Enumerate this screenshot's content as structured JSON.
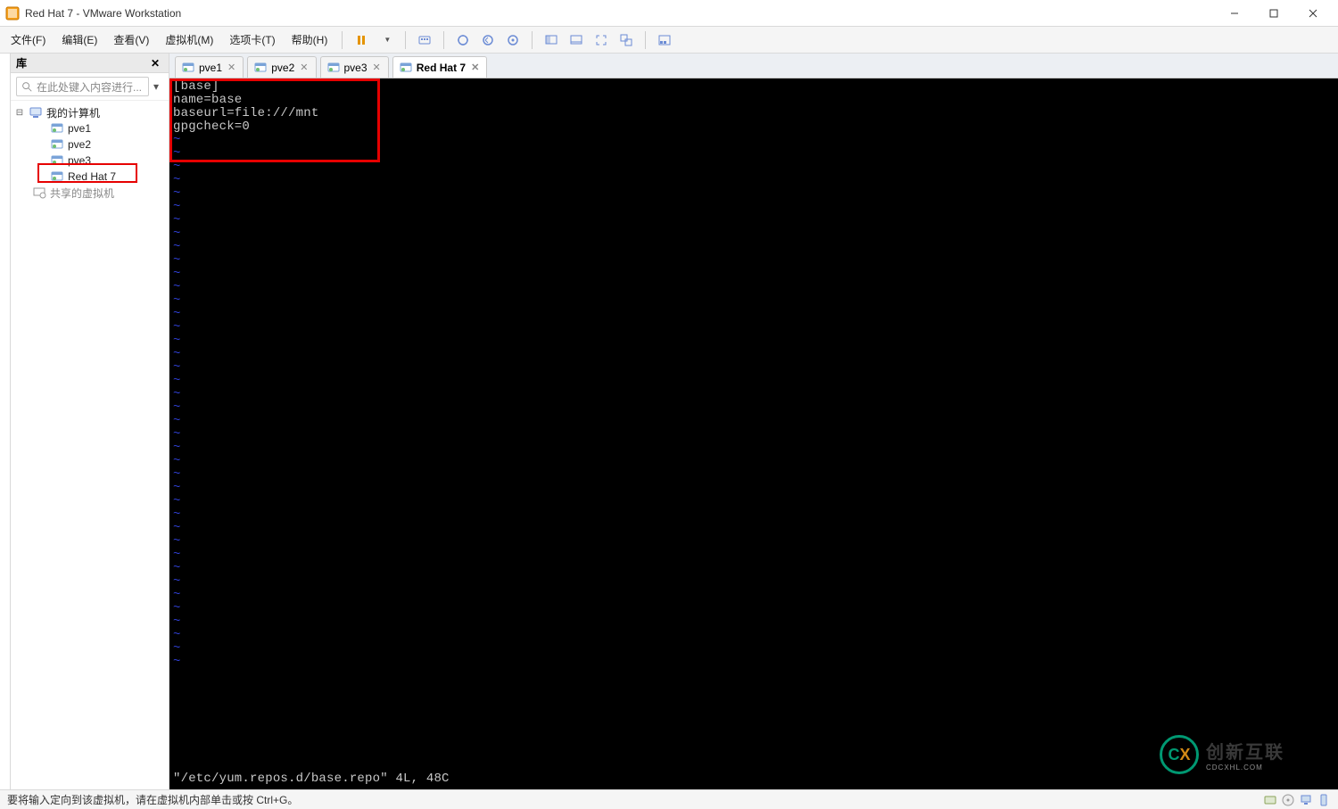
{
  "window": {
    "title": "Red Hat 7 - VMware Workstation"
  },
  "menubar": {
    "items": [
      "文件(F)",
      "编辑(E)",
      "查看(V)",
      "虚拟机(M)",
      "选项卡(T)",
      "帮助(H)"
    ]
  },
  "toolbar": {
    "icons": [
      "pause-icon",
      "power-dropdown",
      "send-keys-icon",
      "snapshot-take-icon",
      "snapshot-revert-icon",
      "snapshot-manager-icon",
      "fit-guest-icon",
      "fullscreen-icon",
      "unity-icon",
      "stretch-icon",
      "thumbnail-bar-icon"
    ]
  },
  "sidebar": {
    "title": "库",
    "search_placeholder": "在此处键入内容进行...",
    "tree": {
      "root": {
        "label": "我的计算机",
        "expanded": true
      },
      "children": [
        {
          "label": "pve1",
          "type": "vm"
        },
        {
          "label": "pve2",
          "type": "vm"
        },
        {
          "label": "pve3",
          "type": "vm"
        },
        {
          "label": "Red Hat 7",
          "type": "vm",
          "highlighted": true
        }
      ],
      "shared": {
        "label": "共享的虚拟机"
      }
    }
  },
  "tabs": [
    {
      "label": "pve1",
      "active": false
    },
    {
      "label": "pve2",
      "active": false
    },
    {
      "label": "pve3",
      "active": false
    },
    {
      "label": "Red Hat 7",
      "active": true
    }
  ],
  "terminal": {
    "content_lines": [
      "[base]",
      "name=base",
      "baseurl=file:///mnt",
      "gpgcheck=0"
    ],
    "tilde_rows": 40,
    "vim_status": "\"/etc/yum.repos.d/base.repo\" 4L, 48C"
  },
  "statusbar": {
    "text": "要将输入定向到该虚拟机，请在虚拟机内部单击或按 Ctrl+G。"
  },
  "watermark": {
    "brand": "创新互联",
    "sub": "CDCXHL.COM"
  },
  "colors": {
    "highlight_red": "#e60000",
    "tilde_blue": "#2f3fd1",
    "logo_green": "#00b386"
  }
}
